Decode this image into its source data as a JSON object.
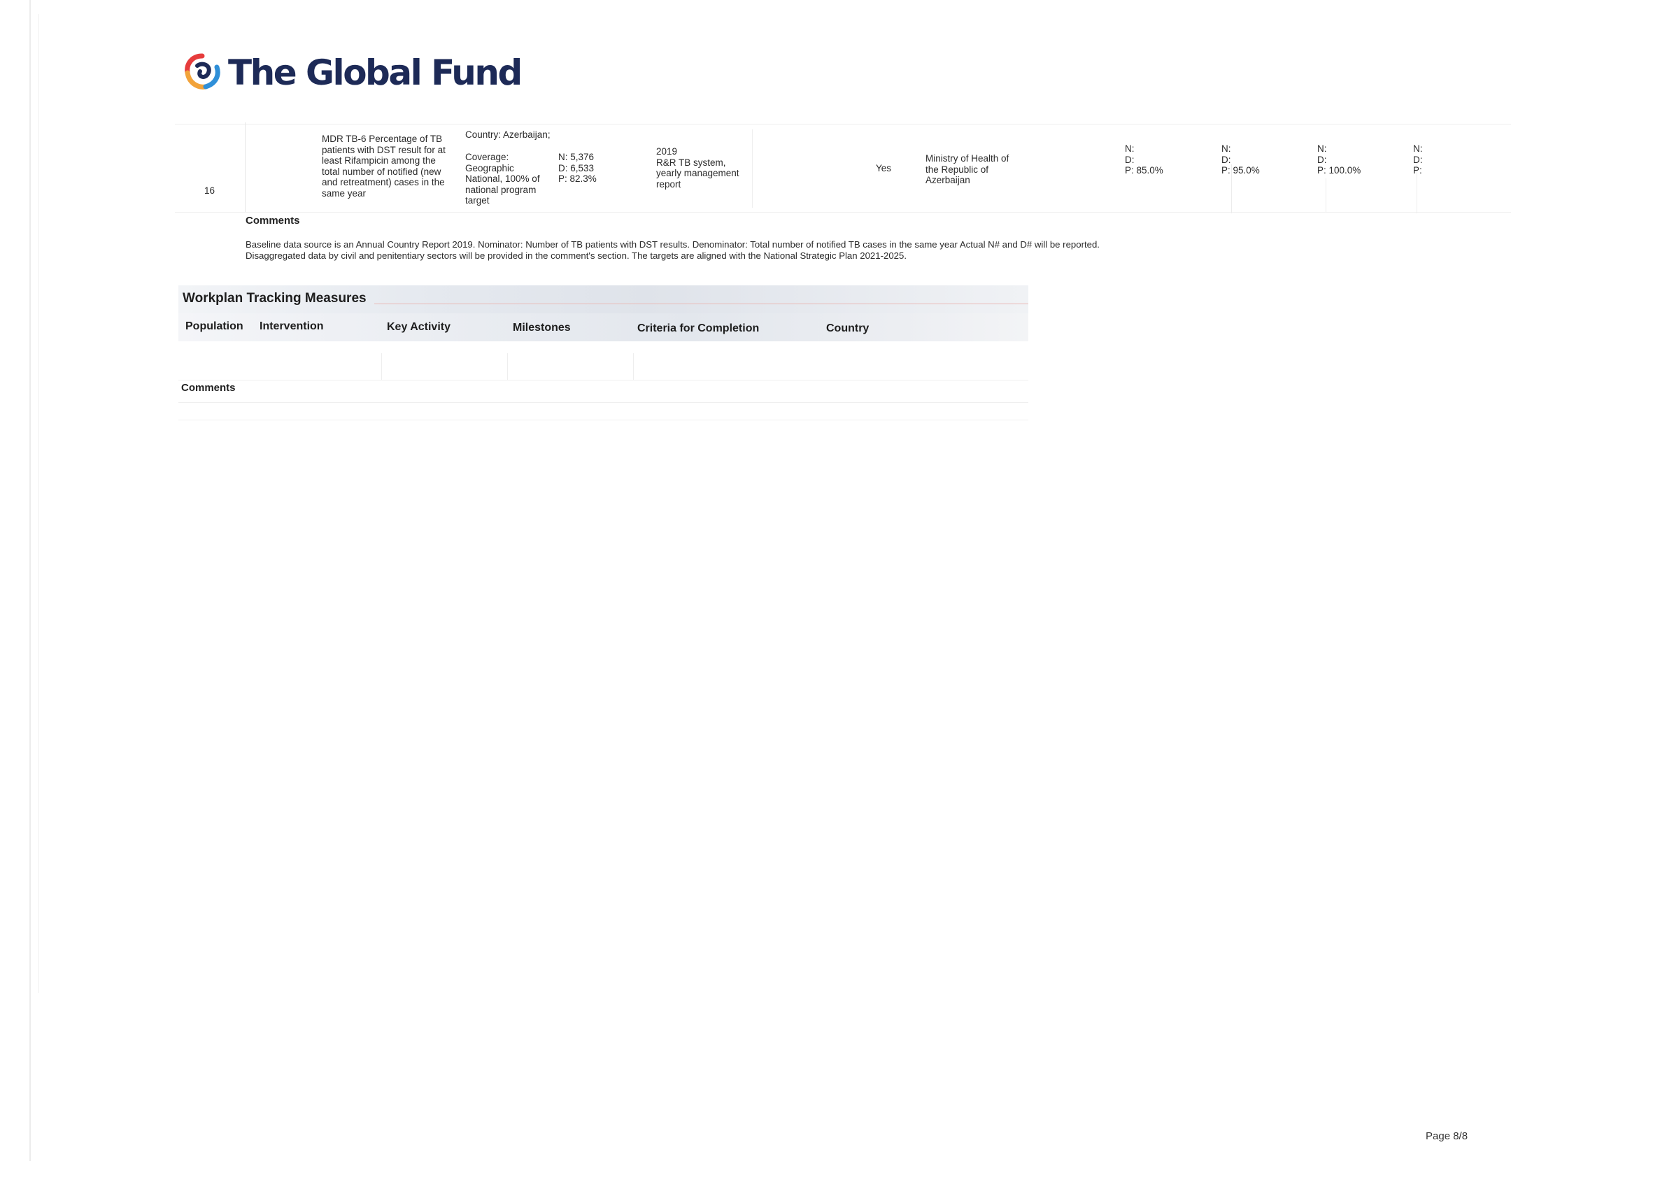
{
  "logo": {
    "text": "The Global Fund",
    "colors": {
      "red": "#e63c3c",
      "orange": "#f2a33a",
      "blue": "#2f8fd8",
      "navy": "#1d2a57"
    }
  },
  "indicator": {
    "row_number": "16",
    "name_lines": [
      "MDR TB-6 Percentage of TB",
      "patients with DST result for at",
      "least Rifampicin among the",
      "total number of notified (new",
      "and retreatment) cases in the",
      "same year"
    ],
    "country": "Country: Azerbaijan;",
    "coverage_lines": [
      "Coverage:",
      "Geographic",
      "National, 100% of",
      "national program",
      "target"
    ],
    "baseline_values": [
      "N: 5,376",
      "D: 6,533",
      "P: 82.3%"
    ],
    "baseline_source_lines": [
      "2019",
      "R&R TB system,",
      "yearly management",
      "report"
    ],
    "required": "Yes",
    "responsible_lines": [
      "Ministry of Health of",
      "the Republic of",
      "Azerbaijan"
    ],
    "targets": [
      {
        "n": "N:",
        "d": "D:",
        "p": "P: 85.0%"
      },
      {
        "n": "N:",
        "d": "D:",
        "p": "P: 95.0%"
      },
      {
        "n": "N:",
        "d": "D:",
        "p": "P: 100.0%"
      },
      {
        "n": "N:",
        "d": "D:",
        "p": "P:"
      }
    ]
  },
  "comments1": {
    "title": "Comments",
    "text": "Baseline data source is an Annual Country Report 2019. Nominator: Number of TB patients with DST results. Denominator: Total number of notified TB cases in the same year Actual N# and D# will be reported. Disaggregated data by civil and penitentiary sectors will be provided in the comment's section. The targets are aligned with the National Strategic Plan 2021-2025."
  },
  "workplan": {
    "title": "Workplan Tracking Measures",
    "columns": [
      "Population",
      "Intervention",
      "Key Activity",
      "Milestones",
      "Criteria for Completion",
      "Country"
    ]
  },
  "comments2": {
    "title": "Comments"
  },
  "footer": {
    "page": "Page 8/8"
  }
}
